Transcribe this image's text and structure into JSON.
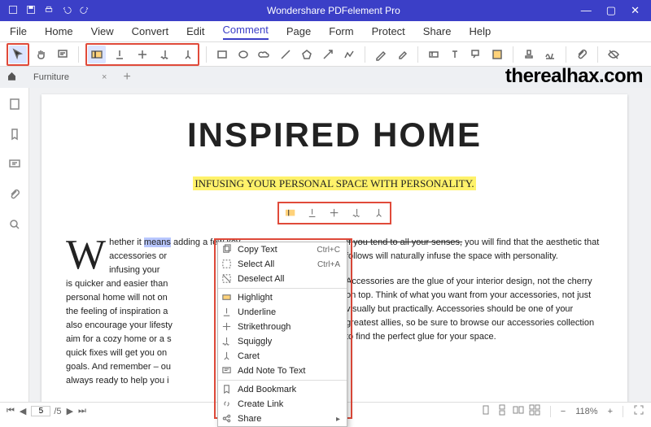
{
  "app": {
    "title": "Wondershare PDFelement Pro"
  },
  "menubar": {
    "items": [
      "File",
      "Home",
      "View",
      "Convert",
      "Edit",
      "Comment",
      "Page",
      "Form",
      "Protect",
      "Share",
      "Help"
    ],
    "active": "Comment"
  },
  "tabs": {
    "current": "Furniture"
  },
  "overlay": {
    "url": "therealhax.com"
  },
  "document": {
    "title": "INSPIRED HOME",
    "subtitle": "INFUSING YOUR PERSONAL SPACE WITH PERSONALITY.",
    "col1": {
      "dropcap": "W",
      "line1a": "hether it ",
      "means": "means",
      "line1b": " adding a few key",
      "l2": "accessories or",
      "l3": "infusing your",
      "l4": "is quicker and easier than",
      "l5": "personal home will not on",
      "l6": "the feeling of inspiration a",
      "l7": "also encourage your lifesty",
      "l8": "aim for a cozy home or a s",
      "l9": "quick fixes will get you on",
      "l10": "goals. And remember – ou",
      "l11": "always ready to help you i"
    },
    "col2": {
      "p1a": "If you tend to all your senses,",
      "p1b": " you will find that the aesthetic that follows will naturally infuse the space with personality.",
      "p2": "Accessories are the glue of your interior design, not the cherry on top. Think of what you want from your accessories, not just visually but practically. Accessories should be one of your greatest allies, so be sure to browse our accessories collection to find the perfect glue for your space."
    }
  },
  "context_menu": {
    "items": [
      {
        "label": "Copy Text",
        "shortcut": "Ctrl+C",
        "icon": "copy"
      },
      {
        "label": "Select All",
        "shortcut": "Ctrl+A",
        "icon": "select-all"
      },
      {
        "label": "Deselect All",
        "shortcut": "",
        "icon": "deselect"
      },
      {
        "sep": true
      },
      {
        "label": "Highlight",
        "icon": "highlight"
      },
      {
        "label": "Underline",
        "icon": "underline"
      },
      {
        "label": "Strikethrough",
        "icon": "strike"
      },
      {
        "label": "Squiggly",
        "icon": "squiggly"
      },
      {
        "label": "Caret",
        "icon": "caret"
      },
      {
        "label": "Add Note To Text",
        "icon": "note"
      },
      {
        "sep": true
      },
      {
        "label": "Add Bookmark",
        "icon": "bookmark"
      },
      {
        "label": "Create Link",
        "icon": "link"
      },
      {
        "label": "Share",
        "icon": "share",
        "submenu": true
      }
    ]
  },
  "status": {
    "page_current": "5",
    "page_total": "/5",
    "zoom": "118%"
  }
}
